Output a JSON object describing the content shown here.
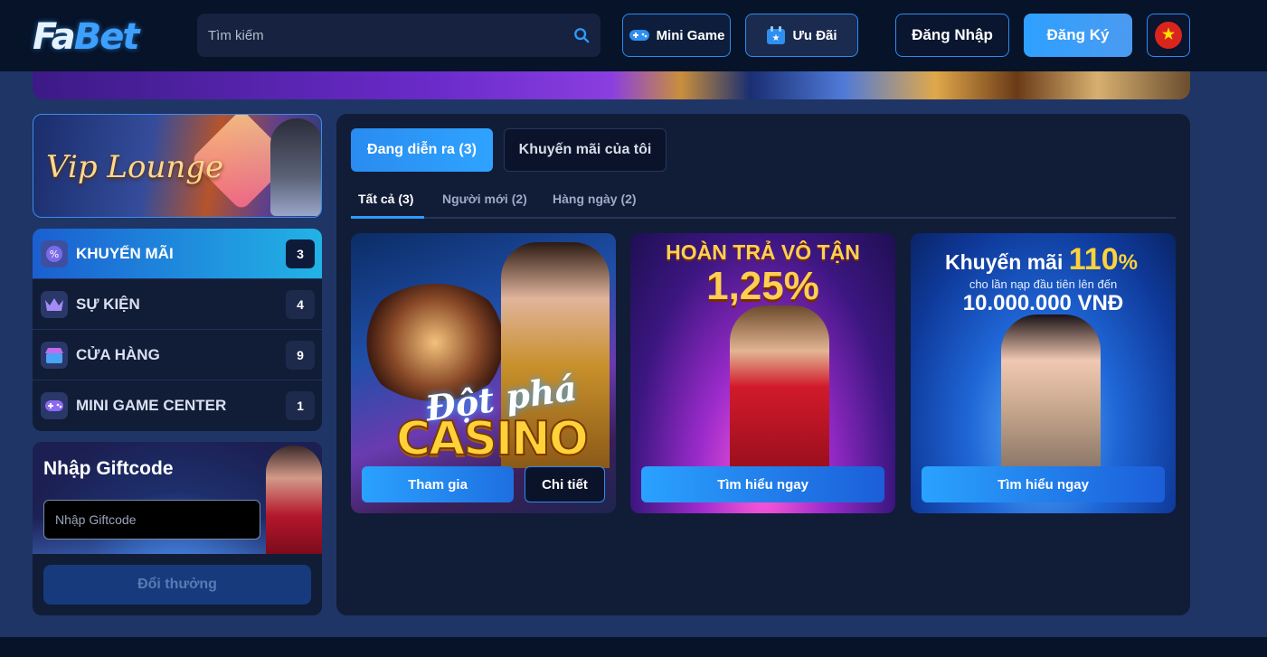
{
  "header": {
    "logo": {
      "part1": "Fa",
      "part2": "Bet"
    },
    "search": {
      "placeholder": "Tìm kiếm"
    },
    "mini_game_label": "Mini Game",
    "uu_dai_label": "Ưu Đãi",
    "login_label": "Đăng Nhập",
    "register_label": "Đăng Ký",
    "flag_star": "★"
  },
  "sidebar": {
    "vip_title": "Vip Lounge",
    "menu": [
      {
        "label": "KHUYẾN MÃI",
        "count": "3",
        "active": true,
        "icon": "percent-icon"
      },
      {
        "label": "SỰ KIỆN",
        "count": "4",
        "active": false,
        "icon": "crown-icon"
      },
      {
        "label": "CỬA HÀNG",
        "count": "9",
        "active": false,
        "icon": "shop-icon"
      },
      {
        "label": "MINI GAME CENTER",
        "count": "1",
        "active": false,
        "icon": "gamepad-icon"
      }
    ],
    "giftcode": {
      "title": "Nhập Giftcode",
      "placeholder": "Nhập Giftcode",
      "button": "Đổi thưởng"
    }
  },
  "main": {
    "tabs": [
      {
        "label": "Đang diễn ra (3)",
        "active": true
      },
      {
        "label": "Khuyến mãi của tôi",
        "active": false
      }
    ],
    "subtabs": [
      {
        "label": "Tất cả (3)",
        "active": true
      },
      {
        "label": "Người mới (2)",
        "active": false
      },
      {
        "label": "Hàng ngày (2)",
        "active": false
      }
    ],
    "cards": [
      {
        "banner_line1": "Đột phá",
        "banner_line2": "CASINO",
        "join_label": "Tham gia",
        "detail_label": "Chi tiết"
      },
      {
        "banner_line1": "HOÀN TRẢ VÔ TẬN",
        "banner_line2": "1,25%",
        "learn_label": "Tìm hiểu ngay"
      },
      {
        "banner_prefix": "Khuyến mãi",
        "banner_value": "110",
        "banner_unit": "%",
        "banner_sub": "cho lần nạp đầu tiên lên đến",
        "banner_amount": "10.000.000 VNĐ",
        "learn_label": "Tìm hiểu ngay"
      }
    ]
  },
  "colors": {
    "accent": "#2e9bff",
    "header_bg": "#061329",
    "page_bg": "#1f3566",
    "panel_bg": "#111c37",
    "gold": "#ffd23a"
  }
}
